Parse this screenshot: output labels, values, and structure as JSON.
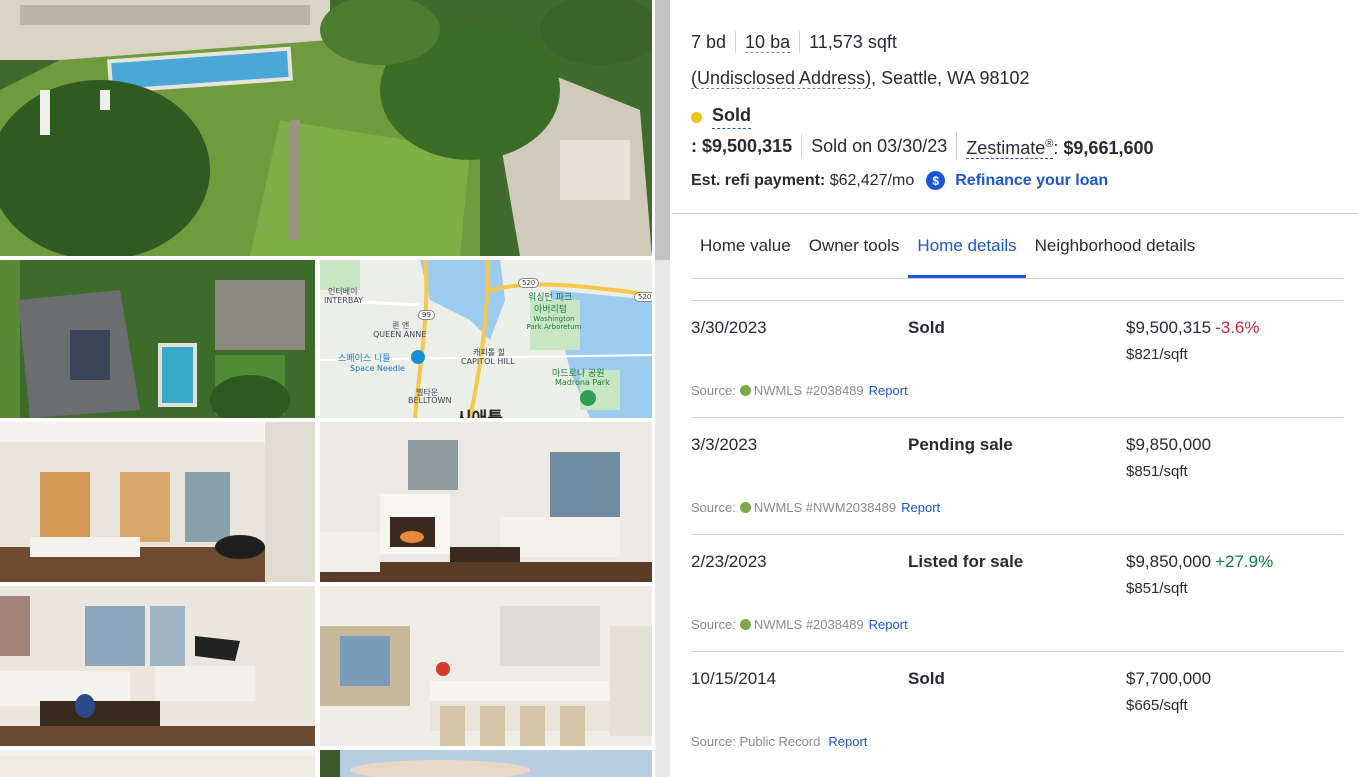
{
  "property": {
    "beds": "7 bd",
    "baths": "10 ba",
    "sqft": "11,573 sqft",
    "address_undisclosed": "(Undisclosed Address)",
    "address_rest": ", Seattle, WA 98102"
  },
  "status": {
    "label": "Sold",
    "dot_color": "#f2c215",
    "price_prefix": ":",
    "price": "$9,500,315",
    "sold_on": "Sold on 03/30/23",
    "zestimate_label": "Zestimate",
    "zestimate_mark": "®",
    "zestimate_colon": ":",
    "zestimate_value": "$9,661,600"
  },
  "refi": {
    "label": "Est. refi payment:",
    "value": "$62,427/mo",
    "icon_char": "$",
    "link": "Refinance your loan"
  },
  "tabs": [
    {
      "label": "Home value",
      "active": false
    },
    {
      "label": "Owner tools",
      "active": false
    },
    {
      "label": "Home details",
      "active": true
    },
    {
      "label": "Neighborhood details",
      "active": false
    }
  ],
  "price_history": [
    {
      "date": "3/30/2023",
      "event": "Sold",
      "price": "$9,500,315",
      "change": "-3.6%",
      "change_dir": "down",
      "per_sqft": "$821/sqft",
      "source_label": "Source:",
      "source": "NWMLS #2038489",
      "source_icon": true,
      "report": "Report"
    },
    {
      "date": "3/3/2023",
      "event": "Pending sale",
      "price": "$9,850,000",
      "change": "",
      "change_dir": "",
      "per_sqft": "$851/sqft",
      "source_label": "Source:",
      "source": "NWMLS #NWM2038489",
      "source_icon": true,
      "report": "Report"
    },
    {
      "date": "2/23/2023",
      "event": "Listed for sale",
      "price": "$9,850,000",
      "change": "+27.9%",
      "change_dir": "up",
      "per_sqft": "$851/sqft",
      "source_label": "Source:",
      "source": "NWMLS #2038489",
      "source_icon": true,
      "report": "Report"
    },
    {
      "date": "10/15/2014",
      "event": "Sold",
      "price": "$7,700,000",
      "change": "",
      "change_dir": "",
      "per_sqft": "$665/sqft",
      "source_label": "Source:",
      "source": "Public Record",
      "source_icon": false,
      "report": "Report"
    }
  ],
  "map": {
    "labels": {
      "interbay": "인터베이",
      "interbay_en": "INTERBAY",
      "queen_anne_ko": "퀸 앤",
      "queen_anne": "QUEEN ANNE",
      "washington_park_ko": "워싱턴 파크",
      "arboretum_ko": "아버리텀",
      "washington_park": "Washington Park Arboretum",
      "space_needle_ko": "스페이스 니들",
      "space_needle": "Space Needle",
      "capitol_hill_ko": "캐피톨 힐",
      "capitol_hill": "CAPITOL HILL",
      "madrona_ko": "마드로나 공원",
      "madrona": "Madrona Park",
      "belltown_ko": "벨타운",
      "belltown": "BELLTOWN",
      "seattle_ko": "시애틀",
      "route_520": "520",
      "route_99": "99"
    }
  },
  "colors": {
    "accent": "#1a56d6",
    "decrease": "#c8283d",
    "increase": "#0c7c3a",
    "sold_dot": "#f2c215"
  }
}
